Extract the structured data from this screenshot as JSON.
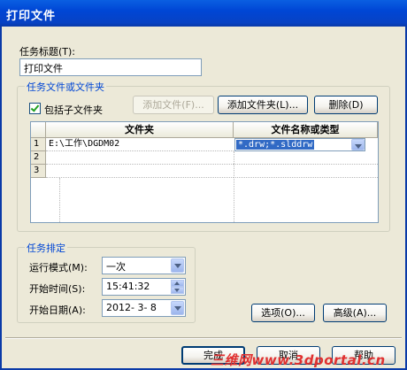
{
  "window": {
    "title": "打印文件"
  },
  "task_title": {
    "label": "任务标题(T):",
    "value": "打印文件"
  },
  "files_group": {
    "title": "任务文件或文件夹",
    "include_subfolders": {
      "label": "包括子文件夹",
      "checked": true
    },
    "add_file_button": "添加文件(F)...",
    "add_folder_button": "添加文件夹(L)...",
    "delete_button": "删除(D)",
    "table": {
      "columns": [
        "文件夹",
        "文件名称或类型"
      ],
      "rows": [
        {
          "num": "1",
          "folder": "E:\\工作\\DGDM02",
          "type": "*.drw;*.slddrw"
        },
        {
          "num": "2",
          "folder": "",
          "type": ""
        },
        {
          "num": "3",
          "folder": "",
          "type": ""
        }
      ]
    }
  },
  "schedule_group": {
    "title": "任务排定",
    "run_mode": {
      "label": "运行模式(M):",
      "value": "一次"
    },
    "start_time": {
      "label": "开始时间(S):",
      "value": "15:41:32"
    },
    "start_date": {
      "label": "开始日期(A):",
      "value": "2012- 3- 8"
    }
  },
  "options_button": "选项(O)...",
  "advanced_button": "高级(A)...",
  "footer": {
    "finish_button": "完成",
    "cancel_button": "取消",
    "help_button": "帮助"
  },
  "watermark": "三维网www.3dportal.cn",
  "colors": {
    "titlebar": "#0046d5",
    "group_title": "#0046d5",
    "selection": "#316ac5",
    "watermark": "#e03030"
  }
}
